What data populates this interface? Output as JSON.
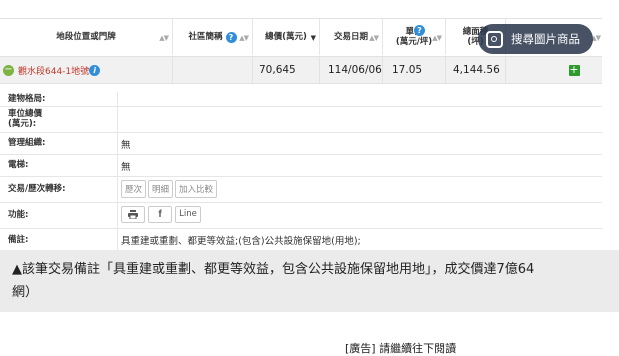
{
  "headers": {
    "location": "地段位置或門牌",
    "community": "社區簡稱",
    "total_price": "總價(萬元)",
    "trade_date": "交易日期",
    "unit_price": "單價\n(萬元/坪)",
    "area": "總面積\n(坪)"
  },
  "row": {
    "address": "觀水段644-1地號",
    "community": "",
    "total_price": "70,645",
    "trade_date": "114/06/06",
    "unit_price": "17.05",
    "area": "4,144.56"
  },
  "details": {
    "building_layout": {
      "label": "建物格局:",
      "value": ""
    },
    "parking_price": {
      "label": "車位總價\n(萬元):",
      "value": ""
    },
    "management": {
      "label": "管理組織:",
      "value": "無"
    },
    "elevator": {
      "label": "電梯:",
      "value": "無"
    },
    "history": {
      "label": "交易/歷次轉移:",
      "buttons": [
        "歷次",
        "明細",
        "加入比較"
      ]
    },
    "function": {
      "label": "功能:",
      "line_label": "Line"
    },
    "remarks": {
      "label": "備註:",
      "value": "具重建或重劃、都更等效益;(包含)公共設施保留地(用地);"
    }
  },
  "caption": {
    "line1": "▲該筆交易備註「具重建或重劃、都更等效益，包含公共設施保留地用地」，成交價達7億64",
    "line2": "網）"
  },
  "overlay": {
    "label": "搜尋圖片商品"
  },
  "bottom_text": "[廣告] 請繼續往下閱讀"
}
